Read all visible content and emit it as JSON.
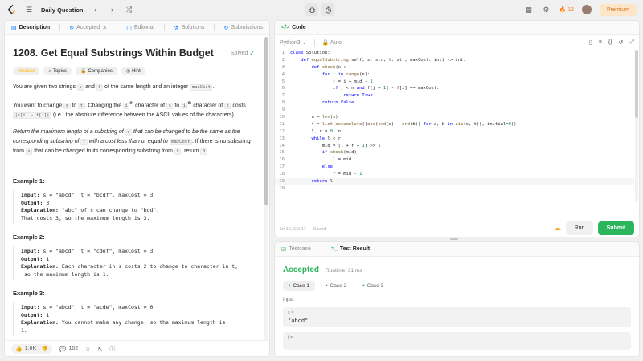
{
  "topbar": {
    "title": "Daily Question",
    "streak": "13",
    "premium": "Premium"
  },
  "description": {
    "tabs": [
      {
        "label": "Description"
      },
      {
        "label": "Accepted"
      },
      {
        "label": "Editorial"
      },
      {
        "label": "Solutions"
      },
      {
        "label": "Submissions"
      }
    ],
    "title": "1208. Get Equal Substrings Within Budget",
    "solved": "Solved",
    "chips": [
      "Medium",
      "Topics",
      "Companies",
      "Hint"
    ],
    "p1": [
      "You are given two strings ",
      "s",
      " and ",
      "t",
      " of the same length and an integer ",
      "maxCost",
      "."
    ],
    "p2": [
      "You want to change ",
      "s",
      " to ",
      "t",
      ". Changing the ",
      "i",
      "th",
      " character of ",
      "s",
      " to ",
      "i",
      "th",
      " character of ",
      "t",
      " costs ",
      "|s[i] - t[i]|",
      " (i.e., the absolute difference between the ASCII values of the characters)."
    ],
    "p3": [
      "Return the maximum length of a substring of ",
      "s",
      " that can be changed to be the same as the corresponding substring of ",
      "t",
      " with a cost less than or equal to ",
      "maxCost",
      ". If there is no substring from ",
      "s",
      " that can be changed to its corresponding substring from ",
      "t",
      ", return ",
      "0",
      "."
    ],
    "examples": [
      {
        "title": "Example 1:",
        "input": "s = \"abcd\", t = \"bcdf\", maxCost = 3",
        "output": "3",
        "explanation": "\"abc\" of s can change to \"bcd\".",
        "explanation2": "That costs 3, so the maximum length is 3."
      },
      {
        "title": "Example 2:",
        "input": "s = \"abcd\", t = \"cdef\", maxCost = 3",
        "output": "1",
        "explanation": "Each character in s costs 2 to change to character in t,",
        "explanation2": " so the maximum length is 1."
      },
      {
        "title": "Example 3:",
        "input": "s = \"abcd\", t = \"acde\", maxCost = 0",
        "output": "1",
        "explanation": "You cannot make any change, so the maximum length is",
        "explanation2": "1."
      }
    ],
    "labels": {
      "input": "Input:",
      "output": "Output:",
      "explanation": "Explanation:"
    },
    "footer": {
      "likes": "1.6K",
      "comments": "102"
    }
  },
  "code": {
    "title": "Code",
    "language": "Python3",
    "autosave": "Auto",
    "lines": [
      "class Solution:",
      "    def equalSubstring(self, s: str, t: str, maxCost: int) -> int:",
      "        def check(x):",
      "            for i in range(n):",
      "                j = i + mid - 1",
      "                if j < n and f[j + 1] - f[i] <= maxCost:",
      "                    return True",
      "            return False",
      "",
      "        n = len(s)",
      "        f = list(accumulate((abs(ord(a) - ord(b)) for a, b in zip(s, t)), initial=0))",
      "        l, r = 0, n",
      "        while l < r:",
      "            mid = (l + r + 1) >> 1",
      "            if check(mid):",
      "                l = mid",
      "            else:",
      "                r = mid - 1",
      "        return l",
      ""
    ],
    "status_pos": "Ln 19, Col 17",
    "status_saved": "Saved",
    "run": "Run",
    "submit": "Submit"
  },
  "result": {
    "tabs": [
      {
        "label": "Testcase"
      },
      {
        "label": "Test Result"
      }
    ],
    "status": "Accepted",
    "runtime": "Runtime: 31 ms",
    "cases": [
      "Case 1",
      "Case 2",
      "Case 3"
    ],
    "input_label": "Input",
    "inputs": [
      {
        "var": "s =",
        "value": "\"abcd\""
      },
      {
        "var": "t =",
        "value": ""
      }
    ]
  },
  "colors": {
    "accent_green": "#2db55d",
    "medium": "#ffb800",
    "premium": "#d3761c"
  }
}
